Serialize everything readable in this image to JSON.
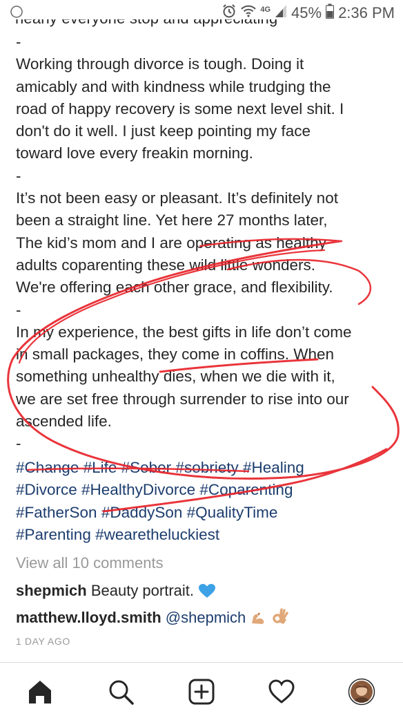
{
  "status_bar": {
    "network": "4G",
    "battery": "45%",
    "time": "2:36 PM"
  },
  "post": {
    "cut_line": "nearly everyone stop and appreciating",
    "lines": [
      "-",
      "Working through divorce is tough. Doing it",
      "amicably and with kindness while trudging the",
      "road of happy recovery is some next level shit. I",
      "don't do it well. I just keep pointing my face",
      "toward love every freakin morning.",
      "-",
      "It’s not been easy or pleasant. It’s definitely not",
      "been a straight line. Yet here 27 months later,",
      "The kid’s mom and I are operating as healthy",
      "adults coparenting these wild little wonders.",
      "We're offering each other grace, and flexibility.",
      "-",
      "In my experience, the best gifts in life don’t come",
      "in small packages, they come in coffins. When",
      "something unhealthy dies, when we die with it,",
      "we are set free through surrender to rise into our",
      "ascended life.",
      "-"
    ],
    "hashtag_lines": [
      "#Change #Life #Sober #sobriety #Healing",
      "#Divorce #HealthyDivorce #Coparenting",
      "#FatherSon #DaddySon #QualityTime",
      "#Parenting #wearetheluckiest"
    ]
  },
  "comments": {
    "view_all": "View all 10 comments",
    "items": [
      {
        "user": "shepmich",
        "text": "Beauty portrait.",
        "emoji": "blue-heart"
      },
      {
        "user": "matthew.lloyd.smith",
        "text": "@shepmich",
        "emoji": "flexed-biceps ok-hand"
      }
    ],
    "time_ago": "1 DAY AGO"
  },
  "colors": {
    "hashtag": "#1c3d6e",
    "annotation": "#e8242b",
    "muted": "#999999"
  },
  "nav": {
    "items": [
      "home-icon",
      "search-icon",
      "new-post-icon",
      "activity-heart-icon",
      "profile-avatar"
    ]
  }
}
